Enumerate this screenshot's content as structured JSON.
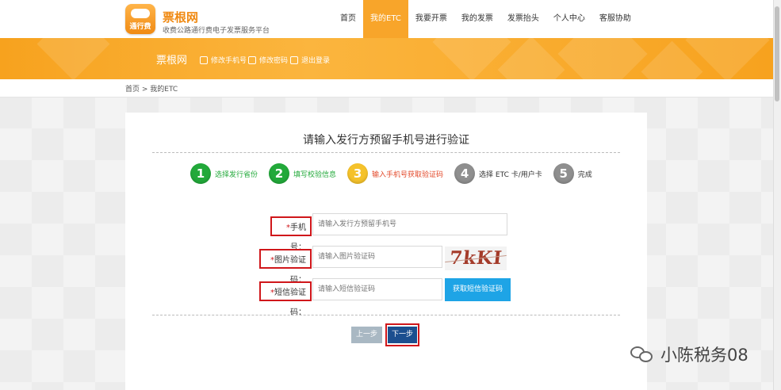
{
  "header": {
    "logo_text": "通行费",
    "brand_name": "票根网",
    "slogan": "收费公路通行费电子发票服务平台",
    "nav": [
      "首页",
      "我的ETC",
      "我要开票",
      "我的发票",
      "发票抬头",
      "个人中心",
      "客服协助"
    ],
    "active_nav": "我的ETC"
  },
  "banner": {
    "title": "票根网",
    "links": [
      "修改手机号",
      "修改密码",
      "退出登录"
    ]
  },
  "breadcrumb": "首页 > 我的ETC",
  "card": {
    "title": "请输入发行方预留手机号进行验证",
    "steps": [
      {
        "num": "1",
        "label": "选择发行省份",
        "state": "done"
      },
      {
        "num": "2",
        "label": "填写校验信息",
        "state": "done"
      },
      {
        "num": "3",
        "label": "输入手机号获取验证码",
        "state": "current"
      },
      {
        "num": "4",
        "label": "选择 ETC 卡/用户卡",
        "state": "todo"
      },
      {
        "num": "5",
        "label": "完成",
        "state": "todo"
      }
    ],
    "form": {
      "phone_label": "手机号：",
      "phone_placeholder": "请输入发行方预留手机号",
      "img_code_label": "图片验证码：",
      "img_code_placeholder": "请输入图片验证码",
      "captcha_text": "7kKI",
      "sms_label": "短信验证码：",
      "sms_placeholder": "请输入短信验证码",
      "sms_button": "获取短信验证码",
      "required_mark": "*"
    },
    "prev_button": "上一步",
    "next_button": "下一步"
  },
  "watermark": "小陈税务08",
  "colors": {
    "brand_orange": "#f8a52a",
    "step_green": "#22a93a",
    "step_yellow": "#f5c22b",
    "step_gray": "#8f8f8f",
    "sms_blue": "#1ea4e6",
    "next_blue": "#1c4f8f",
    "highlight_red": "#d0171b"
  }
}
